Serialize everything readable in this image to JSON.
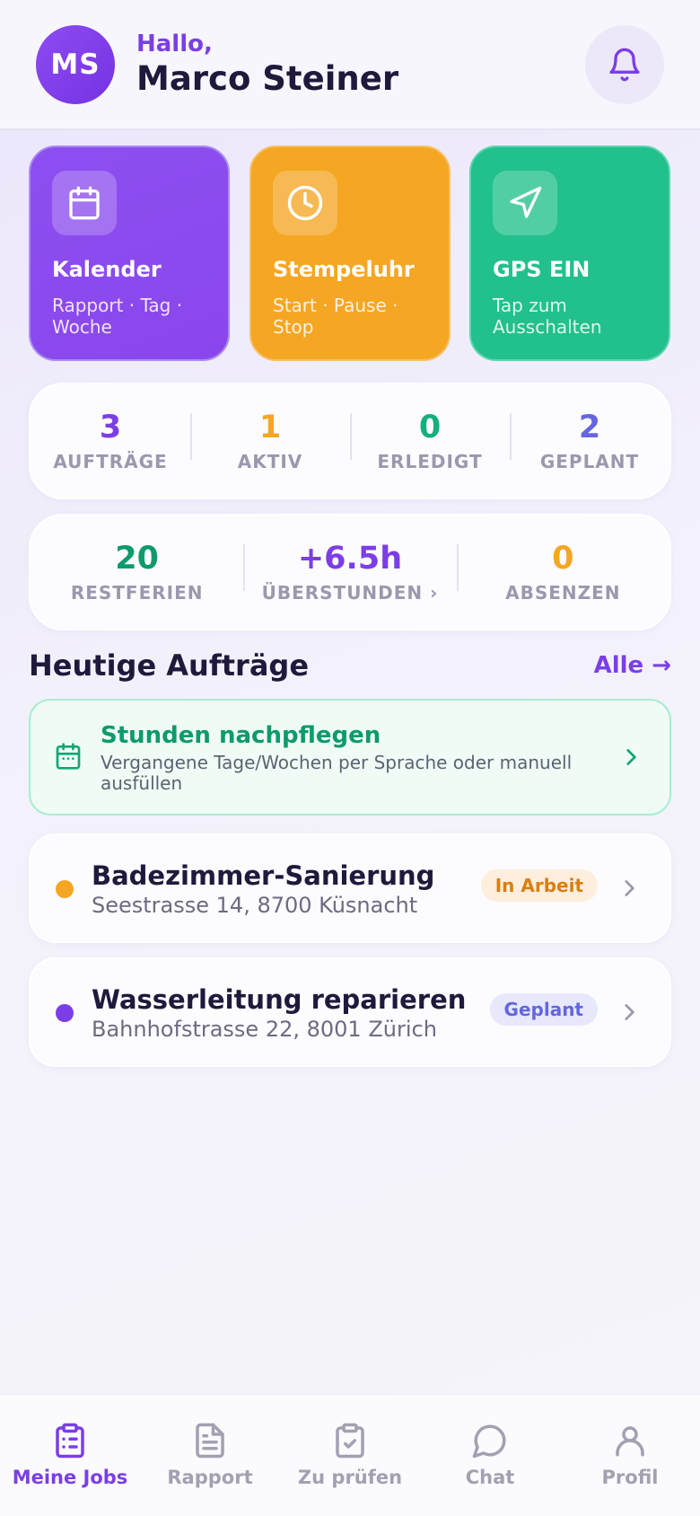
{
  "colors": {
    "accent": "#7b3ee6",
    "orange": "#f5a623",
    "green": "#22c08c",
    "indigo": "#6366e0",
    "badge_orange_bg": "#fdeedd",
    "badge_orange_fg": "#d97f0e",
    "badge_indigo_bg": "#e7e8fb",
    "badge_indigo_fg": "#6366e0"
  },
  "header": {
    "initials": "MS",
    "greeting": "Hallo,",
    "name": "Marco Steiner",
    "bell_icon": "bell-icon"
  },
  "tiles": [
    {
      "icon": "calendar-icon",
      "title": "Kalender",
      "subtitle": "Rapport · Tag · Woche"
    },
    {
      "icon": "clock-icon",
      "title": "Stempeluhr",
      "subtitle": "Start · Pause · Stop"
    },
    {
      "icon": "navigation-arrow-icon",
      "title": "GPS EIN",
      "subtitle": "Tap zum Ausschalten"
    }
  ],
  "job_stats": [
    {
      "value": "3",
      "label": "AUFTRÄGE",
      "color": "#7b3ee6"
    },
    {
      "value": "1",
      "label": "AKTIV",
      "color": "#f5a623"
    },
    {
      "value": "0",
      "label": "ERLEDIGT",
      "color": "#12b07c"
    },
    {
      "value": "2",
      "label": "GEPLANT",
      "color": "#6366e0"
    }
  ],
  "time_stats": [
    {
      "value": "20",
      "label": "RESTFERIEN",
      "color": "#0e9a6b"
    },
    {
      "value": "+6.5h",
      "label": "ÜBERSTUNDEN ›",
      "color": "#7b3ee6"
    },
    {
      "value": "0",
      "label": "ABSENZEN",
      "color": "#f5a623"
    }
  ],
  "today": {
    "title": "Heutige Aufträge",
    "all_link": "Alle →"
  },
  "hours_banner": {
    "icon": "calendar-icon",
    "title": "Stunden nachpflegen",
    "subtitle": "Vergangene Tage/Wochen per Sprache oder manuell ausfüllen"
  },
  "jobs": [
    {
      "title": "Badezimmer-Sanierung",
      "address": "Seestrasse 14, 8700 Küsnacht",
      "status": "In Arbeit",
      "dot_color": "#f5a623"
    },
    {
      "title": "Wasserleitung reparieren",
      "address": "Bahnhofstrasse 22, 8001 Zürich",
      "status": "Geplant",
      "dot_color": "#7b3ee6"
    }
  ],
  "nav": [
    {
      "icon": "clipboard-list-icon",
      "label": "Meine Jobs",
      "active": true
    },
    {
      "icon": "file-text-icon",
      "label": "Rapport",
      "active": false
    },
    {
      "icon": "clipboard-check-icon",
      "label": "Zu prüfen",
      "active": false
    },
    {
      "icon": "chat-bubble-icon",
      "label": "Chat",
      "active": false
    },
    {
      "icon": "user-icon",
      "label": "Profil",
      "active": false
    }
  ]
}
